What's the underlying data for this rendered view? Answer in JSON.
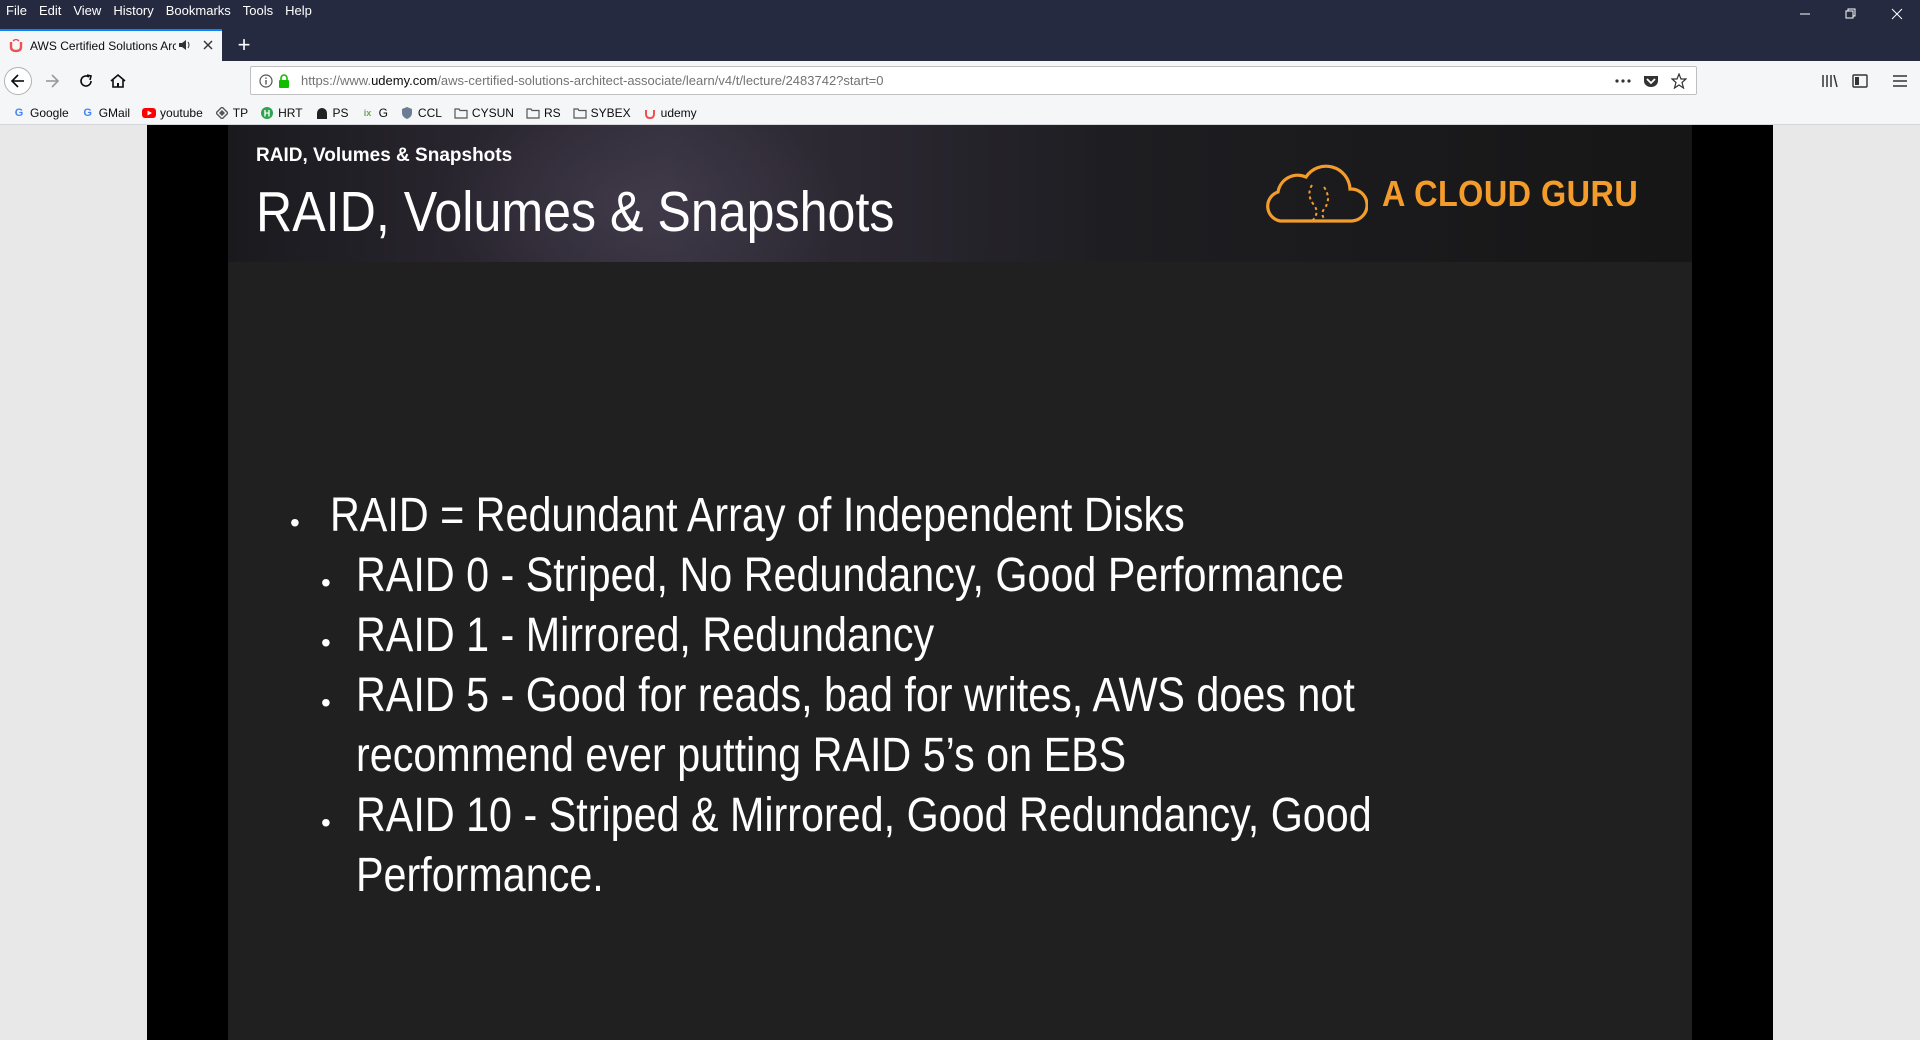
{
  "menubar": {
    "items": [
      "File",
      "Edit",
      "View",
      "History",
      "Bookmarks",
      "Tools",
      "Help"
    ]
  },
  "tab": {
    "title": "AWS Certified Solutions Arc",
    "favicon": "udemy-logo",
    "audio_icon": "speaker-icon",
    "close_icon": "close-icon"
  },
  "new_tab_label": "+",
  "urlbar": {
    "url_prefix": "https://www.",
    "url_host": "udemy.com",
    "url_path": "/aws-certified-solutions-architect-associate/learn/v4/t/lecture/2483742?start=0"
  },
  "bookmarks": [
    {
      "label": "Google",
      "icon": "G",
      "color": "#4285f4"
    },
    {
      "label": "GMail",
      "icon": "G",
      "color": "#4285f4"
    },
    {
      "label": "youtube",
      "icon": "▶",
      "color": "#ff0000"
    },
    {
      "label": "TP",
      "icon": "◈",
      "color": "#555555"
    },
    {
      "label": "HRT",
      "icon": "H",
      "color": "#2ea44f"
    },
    {
      "label": "PS",
      "icon": "▲",
      "color": "#222222"
    },
    {
      "label": "G",
      "icon": "ix",
      "color": "#6aa84f"
    },
    {
      "label": "CCL",
      "icon": "◉",
      "color": "#6b7c93"
    },
    {
      "label": "CYSUN",
      "icon": "folder",
      "color": "#555555"
    },
    {
      "label": "RS",
      "icon": "folder",
      "color": "#555555"
    },
    {
      "label": "SYBEX",
      "icon": "folder",
      "color": "#555555"
    },
    {
      "label": "udemy",
      "icon": "u",
      "color": "#ec5252"
    }
  ],
  "slide": {
    "small_title": "RAID, Volumes & Snapshots",
    "title": "RAID, Volumes & Snapshots",
    "logo_text": "A CLOUD GURU",
    "bullet_main": "RAID = Redundant Array of Independent Disks",
    "sub_bullets": [
      [
        "RAID 0 - Striped, No Redundancy, Good Performance"
      ],
      [
        "RAID 1 - Mirrored, Redundancy"
      ],
      [
        "RAID 5 - Good for reads, bad for writes, AWS does not",
        "recommend ever putting RAID 5’s on EBS"
      ],
      [
        "RAID 10 - Striped & Mirrored, Good Redundancy, Good",
        "Performance."
      ]
    ]
  },
  "colors": {
    "chrome_dark": "#252a40",
    "accent_tab": "#0a84ff",
    "logo_orange": "#f39c2b",
    "slide_bg": "#202020"
  }
}
